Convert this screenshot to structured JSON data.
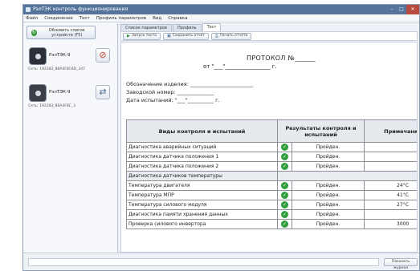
{
  "window": {
    "title": "РэлТЭК контроль функционирования"
  },
  "menu": [
    "Файл",
    "Соединение",
    "Тест",
    "Профиль параметров",
    "Вид",
    "Справка"
  ],
  "sidebar": {
    "search_button": "Обновить список устройств (F5)",
    "devices": [
      {
        "name": "РэлТЭК-9",
        "serial": "Сеть: 192283_88A4F8C8D_347",
        "action_icon": "tools-icon"
      },
      {
        "name": "РэлТЭК-9",
        "serial": "Сеть: 192283_88A4F8C_3",
        "action_icon": "connect-icon"
      }
    ]
  },
  "tabs": [
    "Список параметров",
    "Профиль",
    "Тест"
  ],
  "active_tab": 2,
  "toolbar": {
    "start": "Запуск теста",
    "save": "Сохранить отчёт",
    "print": "Печать отчёта"
  },
  "document": {
    "title": "ПРОТОКОЛ №______",
    "date_line": "от \"___\"________________ г.",
    "fields": [
      "Обозначение изделия: ________________________",
      "Заводской номер: ______________",
      "Дата испытаний: \"___\"__________ г."
    ]
  },
  "table": {
    "headers": [
      "Виды контроля и испытаний",
      "Результаты контроля и испытаний",
      "Примечание"
    ],
    "rows": [
      {
        "name": "Диагностика аварийных ситуаций",
        "status": "Пройден.",
        "note": ""
      },
      {
        "name": "Диагностика датчика положения 1",
        "status": "Пройден.",
        "note": ""
      },
      {
        "name": "Диагностика датчика положения 2",
        "status": "Пройден.",
        "note": ""
      },
      {
        "name": "Диагностика датчиков температуры",
        "section": true
      },
      {
        "name": "Температура двигателя",
        "status": "Пройден.",
        "note": "24°С"
      },
      {
        "name": "Температура МПР",
        "status": "Пройден.",
        "note": "41°С"
      },
      {
        "name": "Температура силового модуля",
        "status": "Пройден.",
        "note": "27°С"
      },
      {
        "name": "Диагностика памяти хранения данных",
        "status": "Пройден.",
        "note": ""
      },
      {
        "name": "Проверка силового инвертора",
        "status": "Пройден.",
        "note": "3000"
      }
    ]
  },
  "statusbar": {
    "show_button": "Показать журнал"
  },
  "colors": {
    "titlebar": "#55749c",
    "check": "#2f9e3d",
    "accent_action": "#c5432f"
  }
}
